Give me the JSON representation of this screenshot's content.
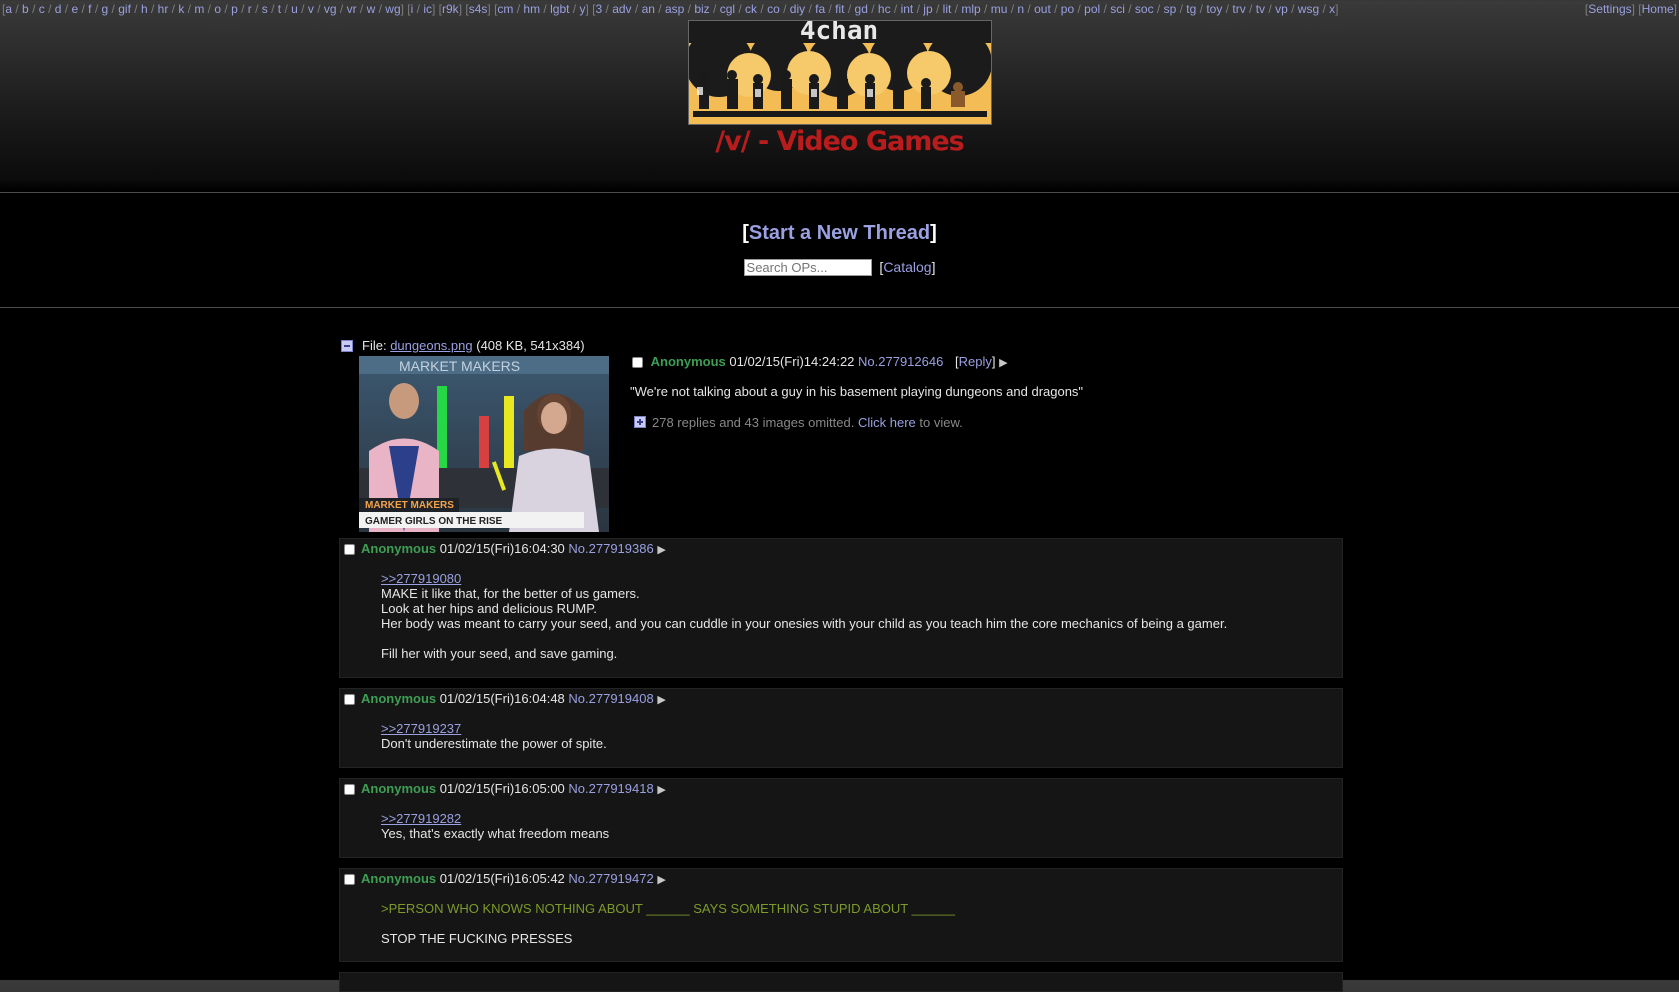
{
  "nav": {
    "groups": [
      [
        "a",
        "b",
        "c",
        "d",
        "e",
        "f",
        "g",
        "gif",
        "h",
        "hr",
        "k",
        "m",
        "o",
        "p",
        "r",
        "s",
        "t",
        "u",
        "v",
        "vg",
        "vr",
        "w",
        "wg"
      ],
      [
        "i",
        "ic"
      ],
      [
        "r9k"
      ],
      [
        "s4s"
      ],
      [
        "cm",
        "hm",
        "lgbt",
        "y"
      ],
      [
        "3",
        "adv",
        "an",
        "asp",
        "biz",
        "cgl",
        "ck",
        "co",
        "diy",
        "fa",
        "fit",
        "gd",
        "hc",
        "int",
        "jp",
        "lit",
        "mlp",
        "mu",
        "n",
        "out",
        "po",
        "pol",
        "sci",
        "soc",
        "sp",
        "tg",
        "toy",
        "trv",
        "tv",
        "vp",
        "wsg",
        "x"
      ]
    ],
    "settings": "Settings",
    "home": "Home"
  },
  "banner": {
    "logo_text": "4chan"
  },
  "board": {
    "title": "/v/ - Video Games"
  },
  "actions": {
    "new_thread": "Start a New Thread",
    "search_placeholder": "Search OPs...",
    "catalog": "Catalog"
  },
  "op": {
    "file_label": "File:",
    "file_name": "dungeons.png",
    "file_meta": "(408 KB, 541x384)",
    "thumb": {
      "caption_brand": "MARKET MAKERS",
      "caption_text": "GAMER GIRLS ON THE RISE",
      "top_text": "MARKET MAKERS"
    },
    "name": "Anonymous",
    "date": "01/02/15(Fri)14:24:22",
    "postno": "No.277912646",
    "reply_label": "Reply",
    "body": "\"We're not talking about a guy in his basement playing dungeons and dragons\"",
    "omitted_text": "278 replies and 43 images omitted.",
    "click_here": "Click here",
    "to_view": "to view."
  },
  "replies": [
    {
      "name": "Anonymous",
      "date": "01/02/15(Fri)16:04:30",
      "postno": "No.277919386",
      "quote": ">>277919080",
      "lines": [
        "MAKE it like that, for the better of us gamers.",
        "Look at her hips and delicious RUMP.",
        "Her body was meant to carry your seed, and you can cuddle in your onesies with your child as you teach him the core mechanics of being a gamer.",
        "",
        "Fill her with your seed, and save gaming."
      ]
    },
    {
      "name": "Anonymous",
      "date": "01/02/15(Fri)16:04:48",
      "postno": "No.277919408",
      "quote": ">>277919237",
      "lines": [
        "Don't underestimate the power of spite."
      ]
    },
    {
      "name": "Anonymous",
      "date": "01/02/15(Fri)16:05:00",
      "postno": "No.277919418",
      "quote": ">>277919282",
      "lines": [
        "Yes, that's exactly what freedom means"
      ]
    },
    {
      "name": "Anonymous",
      "date": "01/02/15(Fri)16:05:42",
      "postno": "No.277919472",
      "greentext": ">PERSON WHO KNOWS NOTHING ABOUT ______ SAYS SOMETHING STUPID ABOUT ______",
      "lines": [
        "STOP THE FUCKING PRESSES"
      ]
    }
  ],
  "colors": {
    "link": "#9aa0e0",
    "name": "#3d9e54",
    "title": "#b91c1c",
    "greentext": "#7d9a2a",
    "reply_bg": "#151515"
  }
}
